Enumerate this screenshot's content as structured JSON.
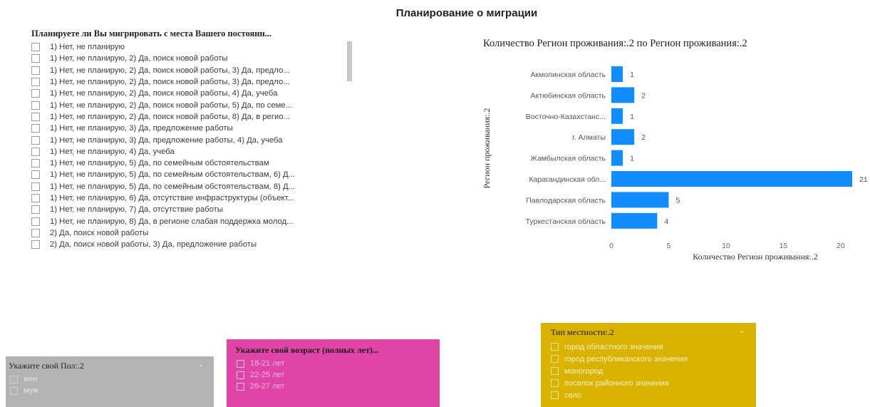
{
  "page_title": "Планирование о миграции",
  "migration_slicer": {
    "title": "Планируете ли Вы мигрировать с места Вашего постоянн...",
    "items": [
      "1) Нет, не планирую",
      "1) Нет, не планирую, 2) Да, поиск новой работы",
      "1) Нет, не планирую, 2) Да, поиск новой работы, 3) Да, предло...",
      "1) Нет, не планирую, 2) Да, поиск новой работы, 3) Да, предло...",
      "1) Нет, не планирую, 2) Да, поиск новой работы, 4) Да, учеба",
      "1) Нет, не планирую, 2) Да, поиск новой работы, 5) Да, по семе...",
      "1) Нет, не планирую, 2) Да, поиск новой работы, 8) Да, в регио...",
      "1) Нет, не планирую, 3) Да, предложение работы",
      "1) Нет, не планирую, 3) Да, предложение работы, 4) Да, учеба",
      "1) Нет, не планирую, 4) Да, учеба",
      "1) Нет, не планирую, 5) Да, по семейным обстоятельствам",
      "1) Нет, не планирую, 5) Да, по семейным обстоятельствам, 6) Д...",
      "1) Нет, не планирую, 5) Да, по семейным обстоятельствам, 8) Д...",
      "1) Нет, не планирую, 6) Да, отсутствие инфраструктуры (объект...",
      "1) Нет, не планирую, 7) Да, отсутствие работы",
      "1) Нет, не планирую, 8) Да, в регионе слабая поддержка молод...",
      "2) Да, поиск новой работы",
      "2) Да, поиск новой работы, 3) Да, предложение работы"
    ]
  },
  "chart_data": {
    "type": "bar",
    "orientation": "horizontal",
    "title": "Количество Регион проживания:.2 по Регион проживания:.2",
    "xlabel": "Количество Регион проживания:.2",
    "ylabel": "Регион проживания:.2",
    "categories": [
      "Акмолинская область",
      "Актюбинская область",
      "Восточно-Казахстанс...",
      "г. Алматы",
      "Жамбылская область",
      "Карагандинская обл...",
      "Павлодарская область",
      "Туркестанская область"
    ],
    "values": [
      1,
      2,
      1,
      2,
      1,
      21,
      5,
      4
    ],
    "xticks": [
      "0",
      "5",
      "10",
      "15",
      "20"
    ],
    "xlim": [
      0,
      21
    ],
    "bar_color": "#118DFF"
  },
  "gender_slicer": {
    "title": "Укажите свой Пол:.2",
    "items": [
      "жен",
      "муж"
    ],
    "bg_color": "#B3B3B3"
  },
  "age_slicer": {
    "title": "Укажите свой возраст (полных лет)...",
    "items": [
      "18-21 лет",
      "22-25 лет",
      "26-27 лет"
    ],
    "bg_color": "#E044A7"
  },
  "locality_slicer": {
    "title": "Тип местности:.2",
    "items": [
      "город областного значения",
      "город республиканского значения",
      "моногород",
      "поселок районного значения",
      "село"
    ],
    "bg_color": "#D9B300"
  }
}
